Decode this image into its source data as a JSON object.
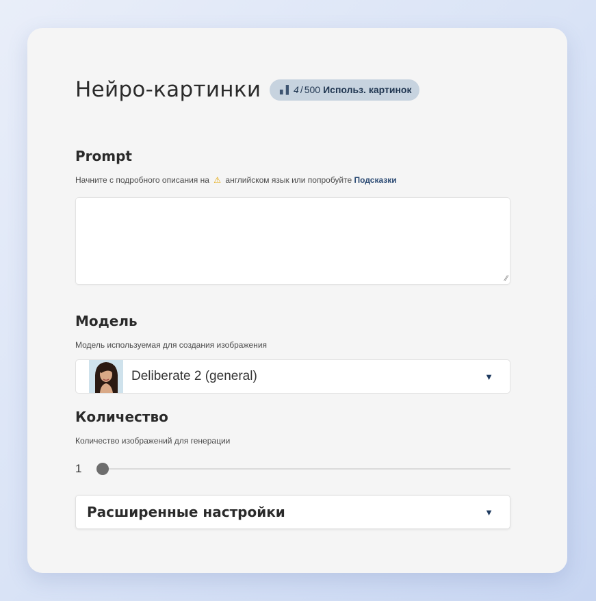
{
  "header": {
    "title": "Нейро-картинки",
    "usage": {
      "icon": "bar-chart-icon",
      "used": "4",
      "separator": "/",
      "total": "500",
      "label": "Использ. картинок"
    }
  },
  "prompt": {
    "title": "Prompt",
    "hint_prefix": "Начните с подробного описания на",
    "warning_icon": "warning-icon",
    "hint_middle": "английском язык или попробуйте",
    "hint_link": "Подсказки",
    "value": "",
    "placeholder": ""
  },
  "model": {
    "title": "Модель",
    "hint": "Модель используемая для создания изображения",
    "selected": "Deliberate 2 (general)"
  },
  "quantity": {
    "title": "Количество",
    "hint": "Количество изображений для генерации",
    "value": "1",
    "slider_fraction": 0
  },
  "advanced": {
    "label": "Расширенные настройки"
  },
  "colors": {
    "accent": "#1e3a5f",
    "badge_bg": "#c7d3df",
    "card_bg": "#f5f5f5"
  }
}
